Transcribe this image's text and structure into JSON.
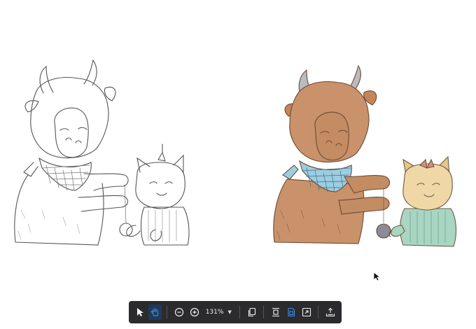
{
  "toolbar": {
    "tools": [
      {
        "name": "select-tool",
        "icon": "arrow-pointer-icon"
      },
      {
        "name": "hand-tool",
        "icon": "hand-icon",
        "active": true
      },
      {
        "name": "zoom-out",
        "icon": "zoom-out-icon"
      },
      {
        "name": "zoom-in",
        "icon": "zoom-in-icon"
      },
      {
        "name": "copy-pages",
        "icon": "copy-icon"
      },
      {
        "name": "fit-width",
        "icon": "fit-width-icon"
      },
      {
        "name": "fit-page",
        "icon": "fit-page-icon"
      },
      {
        "name": "fullscreen",
        "icon": "expand-icon"
      },
      {
        "name": "export",
        "icon": "export-tray-icon"
      }
    ],
    "zoom_level": "131%"
  },
  "colors": {
    "toolbar_bg": "#2b2b2d",
    "accent": "#3a8ee6",
    "cow_fur": "#c9926a",
    "scarf": "#8fc4d8",
    "sweater": "#a9d6c2",
    "dog_fur": "#f0d7a6"
  }
}
